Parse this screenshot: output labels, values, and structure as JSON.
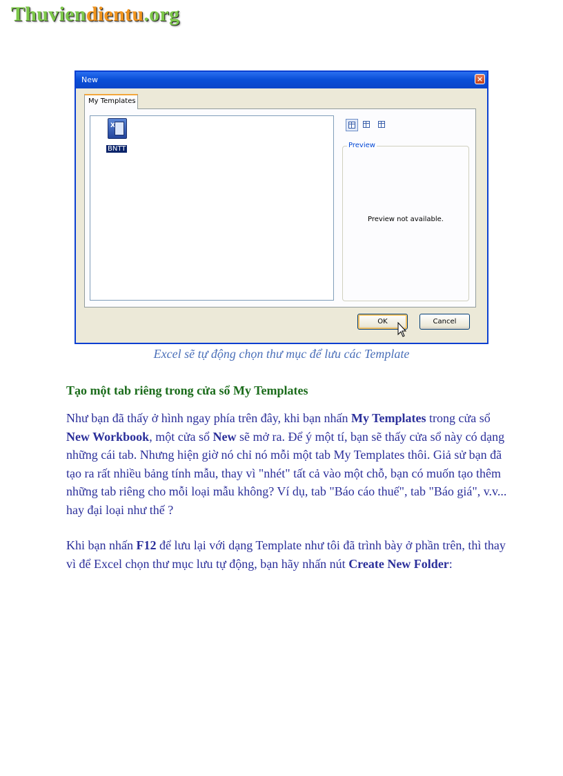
{
  "logo": {
    "part1": "Thuvien",
    "part2": "dientu",
    "part3": ".org"
  },
  "dialog": {
    "title": "New",
    "close_glyph": "×",
    "tab_label": "My Templates",
    "file_label": "BNTT",
    "file_icon_glyph": "X",
    "view_icons": [
      "large-icons-icon",
      "list-view-icon",
      "details-view-icon"
    ],
    "preview_label": "Preview",
    "preview_text": "Preview not available.",
    "ok_label": "OK",
    "cancel_label": "Cancel"
  },
  "caption": "Excel sẽ tự động chọn thư mục để lưu các Template",
  "heading": "Tạo một tab riêng trong cửa sổ My Templates",
  "paragraph1": {
    "t1": "Như bạn đã thấy ở hình ngay phía trên đây, khi bạn nhấn ",
    "b1": "My Templates",
    "t2": " trong cửa sổ ",
    "b2": "New Workbook",
    "t3": ", một cửa sổ ",
    "b3": "New",
    "t4": " sẽ mở ra. Để ý một tí, bạn sẽ thấy cửa sổ này có dạng những cái tab. Nhưng hiện giờ nó chỉ nó mỗi một tab My Templates thôi. Giả sử bạn đã tạo ra rất nhiều bảng tính mẫu, thay vì \"nhét\" tất cả vào một chỗ, bạn có muốn tạo thêm những tab riêng cho mỗi loại mẫu không? Ví dụ, tab \"Báo cáo thuế\", tab \"Báo giá\", v.v... hay đại loại như thế ?"
  },
  "paragraph2": {
    "t1": "Khi bạn nhấn ",
    "b1": "F12",
    "t2": " để lưu lại với dạng Template như tôi đã trình bày ở phần trên, thì thay vì để Excel chọn thư mục lưu tự động, bạn hãy nhấn nút ",
    "b2": "Create New Folder",
    "t3": ":"
  },
  "colors": {
    "logo_green": "#7dc84a",
    "logo_orange": "#f2951e",
    "caption": "#4a6fb8",
    "heading": "#1a6b1a",
    "body_text": "#2b2f9a",
    "titlebar": "#0a4fd8"
  }
}
